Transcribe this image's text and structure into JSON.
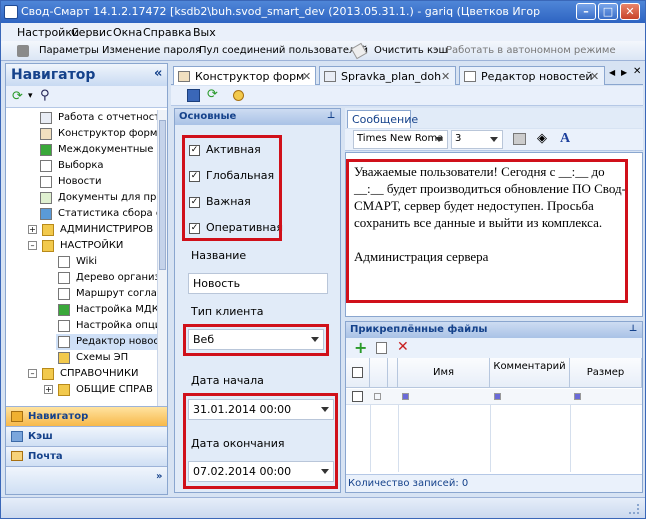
{
  "window": {
    "title": "Свод-Смарт 14.1.2.17472 [ksdb2\\buh.svod_smart_dev (2013.05.31.1.) - gariq (Цветков Игорь Владимирович)"
  },
  "menu": [
    "Настройки",
    "Сервис",
    "Окна",
    "Справка",
    "Вых"
  ],
  "toolbar": {
    "params": "Параметры",
    "change_password": "Изменение пароля",
    "pool": "Пул соединений пользователей",
    "clear_cache": "Очистить кэш",
    "offline": "Работать в автономном режиме"
  },
  "navigator": {
    "title": "Навигатор",
    "collapse": "«",
    "items": [
      {
        "label": "Работа с отчетност"
      },
      {
        "label": "Конструктор форм"
      },
      {
        "label": "Междокументные К"
      },
      {
        "label": "Выборка"
      },
      {
        "label": "Новости"
      },
      {
        "label": "Документы для про"
      },
      {
        "label": "Статистика сбора о"
      },
      {
        "label": "АДМИНИСТРИРОВ"
      },
      {
        "label": "НАСТРОЙКИ"
      },
      {
        "label": "Wiki"
      },
      {
        "label": "Дерево организ"
      },
      {
        "label": "Маршрут согласо"
      },
      {
        "label": "Настройка МДКС"
      },
      {
        "label": "Настройка опци"
      },
      {
        "label": "Редактор новост"
      },
      {
        "label": "Схемы ЭП"
      },
      {
        "label": "СПРАВОЧНИКИ"
      },
      {
        "label": "ОБЩИЕ СПРАВ"
      }
    ],
    "buttons": {
      "nav": "Навигатор",
      "cache": "Кэш",
      "mail": "Почта"
    }
  },
  "tabs": [
    "Конструктор форм",
    "Spravka_plan_doh",
    "Редактор новостей"
  ],
  "basic": {
    "header": "Основные",
    "checks": [
      {
        "label": "Активная",
        "checked": true
      },
      {
        "label": "Глобальная",
        "checked": true
      },
      {
        "label": "Важная",
        "checked": true
      },
      {
        "label": "Оперативная",
        "checked": true
      }
    ],
    "name_label": "Название",
    "name_value": "Новость",
    "client_label": "Тип клиента",
    "client_value": "Веб",
    "start_label": "Дата начала",
    "start_value": "31.01.2014 00:00",
    "end_label": "Дата окончания",
    "end_value": "07.02.2014 00:00"
  },
  "editor": {
    "tab": "Сообщение",
    "font": "Times New Roma",
    "size": "3",
    "text": "Уважаемые пользователи! Сегодня с __:__ до  __:__ будет производиться обновление ПО Свод-СМАРТ, сервер будет недоступен. Просьба сохранить все данные и выйти из комплекса.\n\nАдминистрация сервера"
  },
  "attachments": {
    "header": "Прикреплённые файлы",
    "cols": [
      "Имя",
      "Комментарий",
      "Размер"
    ],
    "status": "Количество записей: 0"
  },
  "colors": {
    "red": "#d0101a",
    "blue": "#15428b"
  }
}
